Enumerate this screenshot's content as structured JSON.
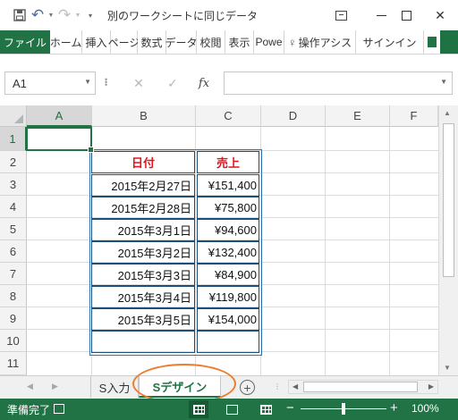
{
  "window": {
    "title": "別のワークシートに同じデータを…",
    "save_icon": "save-icon",
    "undo_icon": "undo-icon",
    "redo_icon": "redo-icon"
  },
  "ribbon_tabs": [
    {
      "label": "ファイル"
    },
    {
      "label": "ホーム"
    },
    {
      "label": "挿入"
    },
    {
      "label": "ページ"
    },
    {
      "label": "数式"
    },
    {
      "label": "データ"
    },
    {
      "label": "校閲"
    },
    {
      "label": "表示"
    },
    {
      "label": "Powe"
    },
    {
      "label": "操作アシス"
    },
    {
      "label": "サインイン"
    }
  ],
  "formula_bar": {
    "name_box": "A1",
    "fx_label": "fx",
    "formula": ""
  },
  "columns": [
    "A",
    "B",
    "C",
    "D",
    "E",
    "F"
  ],
  "rows": [
    "1",
    "2",
    "3",
    "4",
    "5",
    "6",
    "7",
    "8",
    "9",
    "10",
    "11"
  ],
  "table": {
    "headers": [
      "日付",
      "売上"
    ],
    "records": [
      {
        "date": "2015年2月27日",
        "amount": "¥151,400"
      },
      {
        "date": "2015年2月28日",
        "amount": "¥75,800"
      },
      {
        "date": "2015年3月1日",
        "amount": "¥94,600"
      },
      {
        "date": "2015年3月2日",
        "amount": "¥132,400"
      },
      {
        "date": "2015年3月3日",
        "amount": "¥84,900"
      },
      {
        "date": "2015年3月4日",
        "amount": "¥119,800"
      },
      {
        "date": "2015年3月5日",
        "amount": "¥154,000"
      }
    ]
  },
  "sheets": [
    {
      "label": "S入力",
      "active": false
    },
    {
      "label": "Sデザイン",
      "active": true
    }
  ],
  "status": {
    "text": "準備完了",
    "zoom": "100%",
    "zoom_minus": "−",
    "zoom_plus": "+"
  },
  "colors": {
    "excel_green": "#217346",
    "header_text": "#e0141e",
    "highlight": "#ec7c30"
  }
}
